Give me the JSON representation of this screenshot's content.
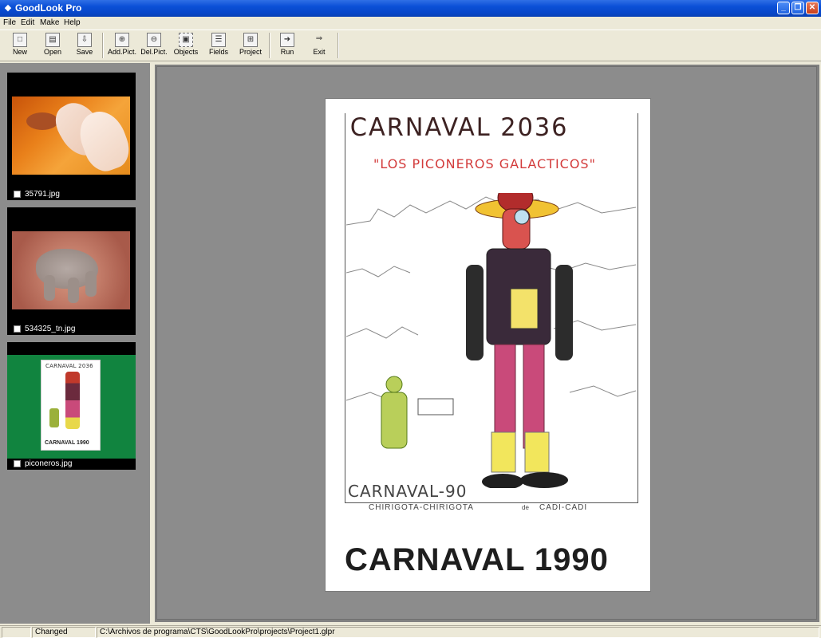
{
  "window": {
    "title": "GoodLook Pro",
    "icon": "app-diamond-icon",
    "minimize_glyph": "_",
    "restore_glyph": "❐",
    "close_glyph": "✕"
  },
  "menu": [
    "File",
    "Edit",
    "Make",
    "Help"
  ],
  "toolbar": {
    "new": "New",
    "open": "Open",
    "save": "Save",
    "add_pict": "Add.Pict.",
    "del_pict": "Del.Pict.",
    "objects": "Objects",
    "fields": "Fields",
    "project": "Project",
    "run": "Run",
    "exit": "Exit"
  },
  "thumbnails": [
    {
      "filename": "35791.jpg",
      "selected": false,
      "checked": false
    },
    {
      "filename": "534325_tn.jpg",
      "selected": false,
      "checked": false
    },
    {
      "filename": "piconeros.jpg",
      "selected": true,
      "checked": false
    }
  ],
  "mini_poster": {
    "title": "CARNAVAL 2036",
    "footer": "CARNAVAL 1990"
  },
  "poster": {
    "heading": "CARNAVAL 2036",
    "subheading": "\"LOS PICONEROS GALACTICOS\"",
    "carnaval90": "CARNAVAL-90",
    "chirigota": "CHIRIGOTA-CHIRIGOTA",
    "de": "de",
    "cadi": "CADI-CADI",
    "bottom": "CARNAVAL 1990"
  },
  "status": {
    "panel1": "",
    "state": "Changed",
    "path": "C:\\Archivos de programa\\CTS\\GoodLookPro\\projects\\Project1.glpr"
  }
}
